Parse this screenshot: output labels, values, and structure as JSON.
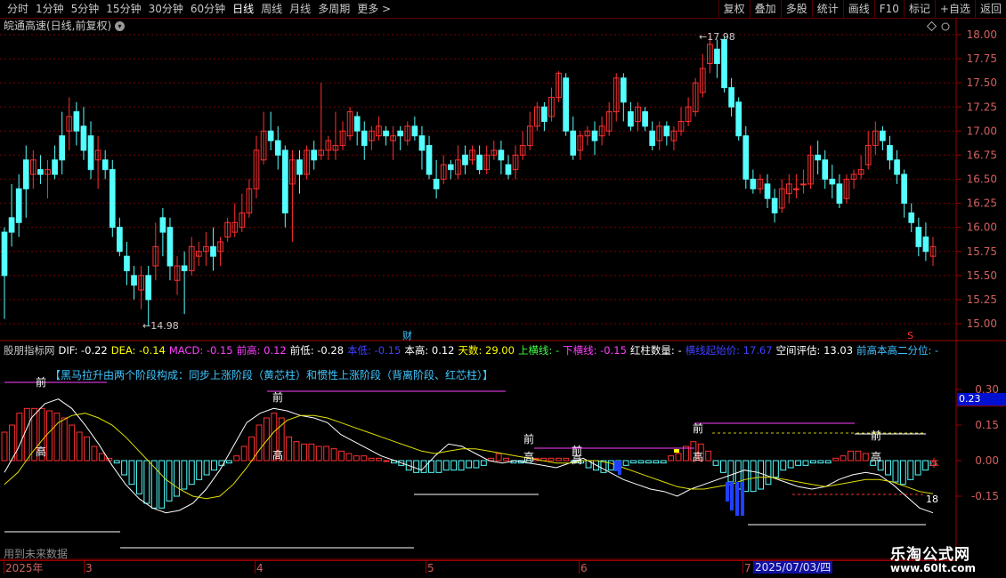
{
  "toolbar": {
    "periods": [
      "分时",
      "1分钟",
      "5分钟",
      "15分钟",
      "30分钟",
      "60分钟",
      "日线",
      "周线",
      "月线",
      "多周期",
      "更多 >"
    ],
    "active": "日线",
    "buttons": [
      "复权",
      "叠加",
      "多股",
      "统计",
      "画线",
      "F10",
      "标记",
      "+自选",
      "返回"
    ]
  },
  "main": {
    "title": "皖通高速(日线,前复权)",
    "y_ticks": [
      "18.00",
      "17.75",
      "17.50",
      "17.25",
      "17.00",
      "16.75",
      "16.50",
      "16.25",
      "16.00",
      "15.75",
      "15.50",
      "15.25",
      "15.00"
    ],
    "high_label": "17.98",
    "low_label": "14.98",
    "cai_marker": "财",
    "s_marker": "S"
  },
  "indicator": {
    "name": "股朋指标网",
    "fields": [
      {
        "label": "DIF: -0.22",
        "color": "#ffffff"
      },
      {
        "label": "DEA: -0.14",
        "color": "#ffff00"
      },
      {
        "label": "MACD: -0.15",
        "color": "#ff40ff"
      },
      {
        "label": "前高: 0.12",
        "color": "#ff40ff"
      },
      {
        "label": "前低: -0.28",
        "color": "#ffffff"
      },
      {
        "label": "本低: -0.15",
        "color": "#4040ff"
      },
      {
        "label": "本高: 0.12",
        "color": "#ffffff"
      },
      {
        "label": "天数: 29.00",
        "color": "#ffff00"
      },
      {
        "label": "上横线: -",
        "color": "#40ff40"
      },
      {
        "label": "下横线: -0.15",
        "color": "#ff40ff"
      },
      {
        "label": "红柱数量: -",
        "color": "#ffffff"
      },
      {
        "label": "横线起始价: 17.67",
        "color": "#4040ff"
      },
      {
        "label": "空间评估: 13.03",
        "color": "#ffffff"
      },
      {
        "label": "前高本高二分位: -",
        "color": "#40c0ff"
      }
    ],
    "note": "【黑马拉升由两个阶段构成：同步上涨阶段（黄芯柱）和惯性上涨阶段（背离阶段、红芯柱）】",
    "y_ticks": [
      "0.30",
      "0.15",
      "0.00",
      "-0.15"
    ],
    "current_value": "0.23",
    "labels_qian": "前",
    "labels_gao": "高",
    "label_ben": "本",
    "label_18": "18",
    "future_note": "用到未来数据"
  },
  "dates": [
    "2025年",
    "3",
    "4",
    "5",
    "6",
    "7"
  ],
  "cursor_date": "2025/07/03/四",
  "watermark": {
    "name": "乐淘公式网",
    "url": "www.60lt.com"
  },
  "colors": {
    "up": "#ff3030",
    "down": "#54ffff",
    "bg": "#000000",
    "grid": "#7a0000"
  }
}
